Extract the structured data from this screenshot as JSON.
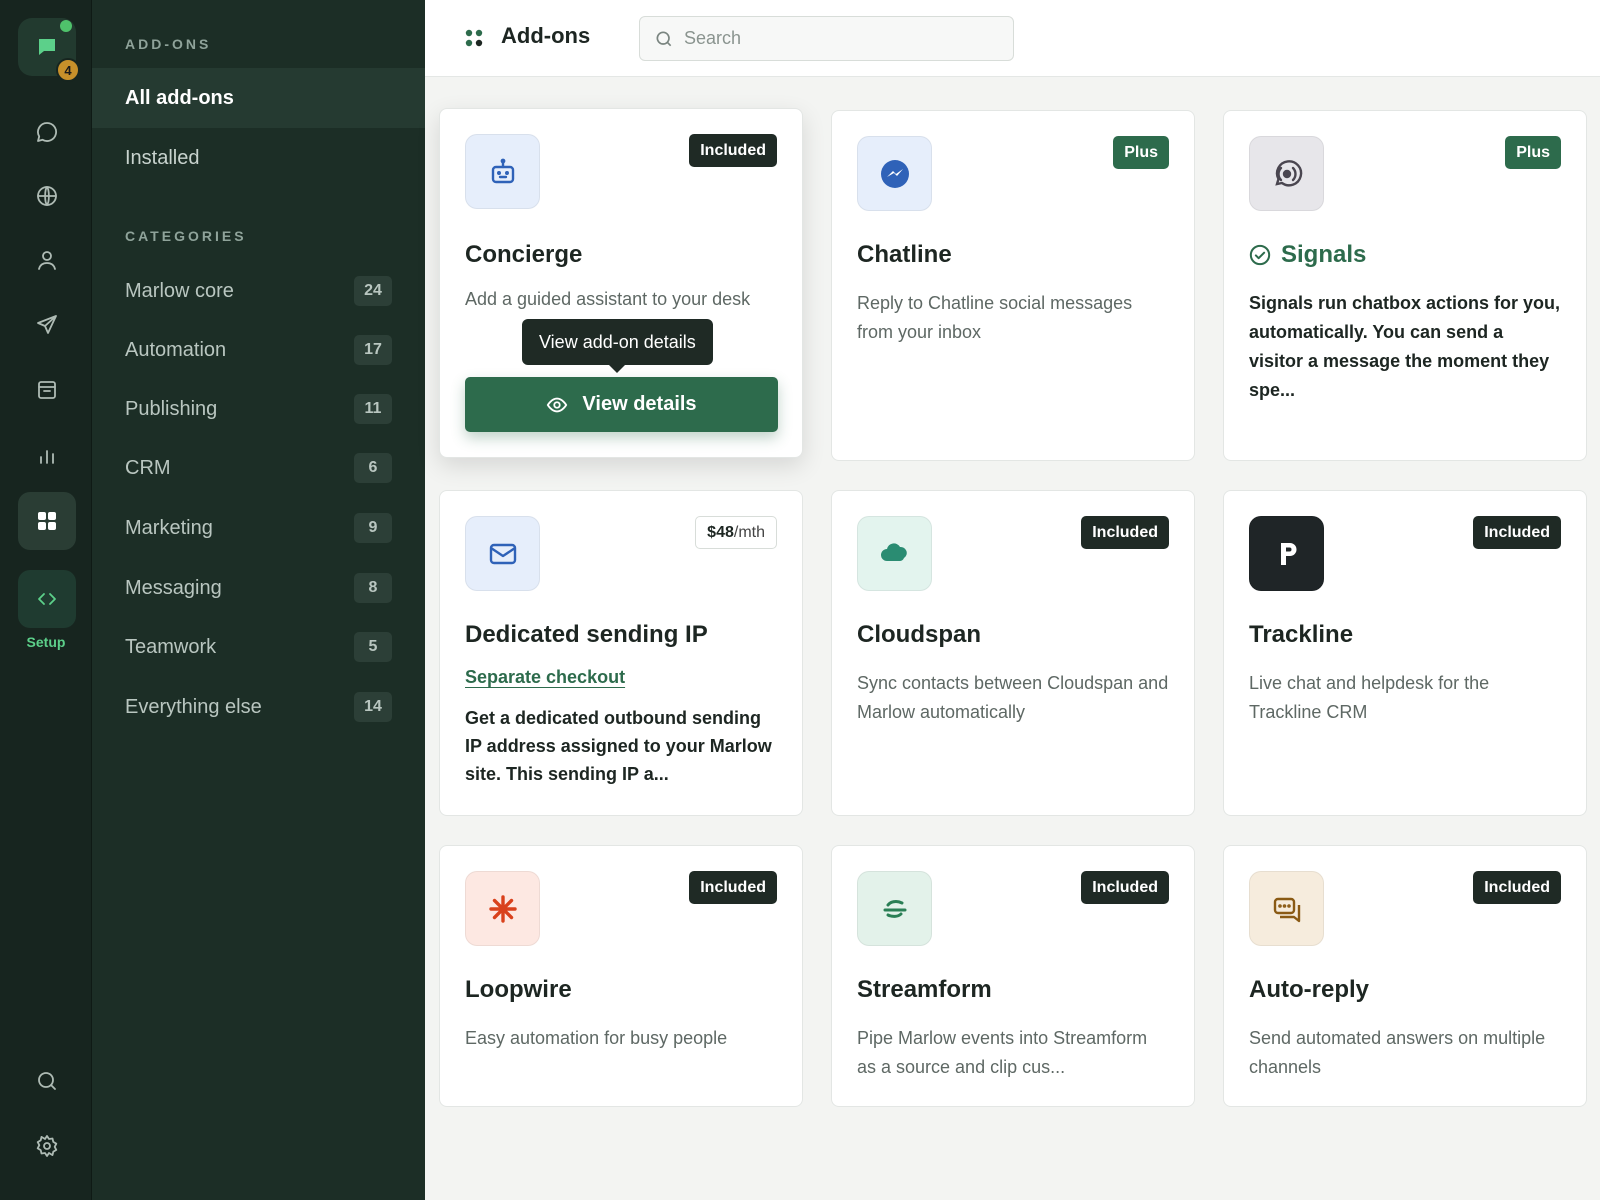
{
  "rail": {
    "notification_count": "4",
    "setup_label": "Setup",
    "icons": [
      "chat-icon",
      "globe-icon",
      "person-icon",
      "send-icon",
      "archive-icon",
      "bar-chart-icon",
      "apps-icon",
      "code-icon",
      "search-icon",
      "gear-icon"
    ]
  },
  "nav": {
    "section_addons": "ADD-ONS",
    "all_addons": "All add-ons",
    "installed": "Installed",
    "section_categories": "CATEGORIES",
    "categories": [
      {
        "label": "Marlow core",
        "count": "24"
      },
      {
        "label": "Automation",
        "count": "17"
      },
      {
        "label": "Publishing",
        "count": "11"
      },
      {
        "label": "CRM",
        "count": "6"
      },
      {
        "label": "Marketing",
        "count": "9"
      },
      {
        "label": "Messaging",
        "count": "8"
      },
      {
        "label": "Teamwork",
        "count": "5"
      },
      {
        "label": "Everything else",
        "count": "14"
      }
    ]
  },
  "header": {
    "title": "Add-ons",
    "search_placeholder": "Search"
  },
  "cards": [
    {
      "title": "Concierge",
      "tag": "Included",
      "desc": "Add a guided assistant to your desk",
      "tooltip": "View add-on details",
      "button": "View details",
      "icon": "robot-icon",
      "icon_bg": "#e6eefb"
    },
    {
      "title": "Chatline",
      "tag": "Plus",
      "desc": "Reply to Chatline social messages from your inbox",
      "icon": "messenger-icon",
      "icon_bg": "#e6eefb"
    },
    {
      "title": "Signals",
      "tag": "Plus",
      "desc": "Signals run chatbox actions for you, automatically. You can send a visitor a message the moment they spe...",
      "icon": "broadcast-icon",
      "icon_bg": "#e7e6ea"
    },
    {
      "title": "Dedicated sending IP",
      "tag_price": "$48",
      "tag_unit": "/mth",
      "link": "Separate checkout",
      "desc": "Get a dedicated outbound sending IP address assigned to your Marlow site. This sending IP a...",
      "icon": "mail-icon",
      "icon_bg": "#e6eefb"
    },
    {
      "title": "Cloudspan",
      "tag": "Included",
      "desc": "Sync contacts between Cloudspan and Marlow automatically",
      "icon": "cloud-icon",
      "icon_bg": "#e3f4ee"
    },
    {
      "title": "Trackline",
      "tag": "Included",
      "desc": "Live chat and helpdesk for the Trackline CRM",
      "icon": "trackline-logo-icon",
      "icon_bg": "#1f2527"
    },
    {
      "title": "Loopwire",
      "tag": "Included",
      "desc": "Easy automation for busy people",
      "icon": "asterisk-icon",
      "icon_bg": "#fde8e2"
    },
    {
      "title": "Streamform",
      "tag": "Included",
      "desc": "Pipe Marlow events into Streamform as a source and clip cus...",
      "icon": "streamform-icon",
      "icon_bg": "#e3f2ea"
    },
    {
      "title": "Auto-reply",
      "tag": "Included",
      "desc": "Send automated answers on multiple channels",
      "icon": "auto-reply-icon",
      "icon_bg": "#f6ecdd"
    }
  ],
  "colors": {
    "rail_bg": "#17251f",
    "nav_bg": "#1c2e26",
    "accent_green": "#2d6b4c",
    "setup_green": "#5cd08a",
    "badge_orange": "#c7902a"
  }
}
